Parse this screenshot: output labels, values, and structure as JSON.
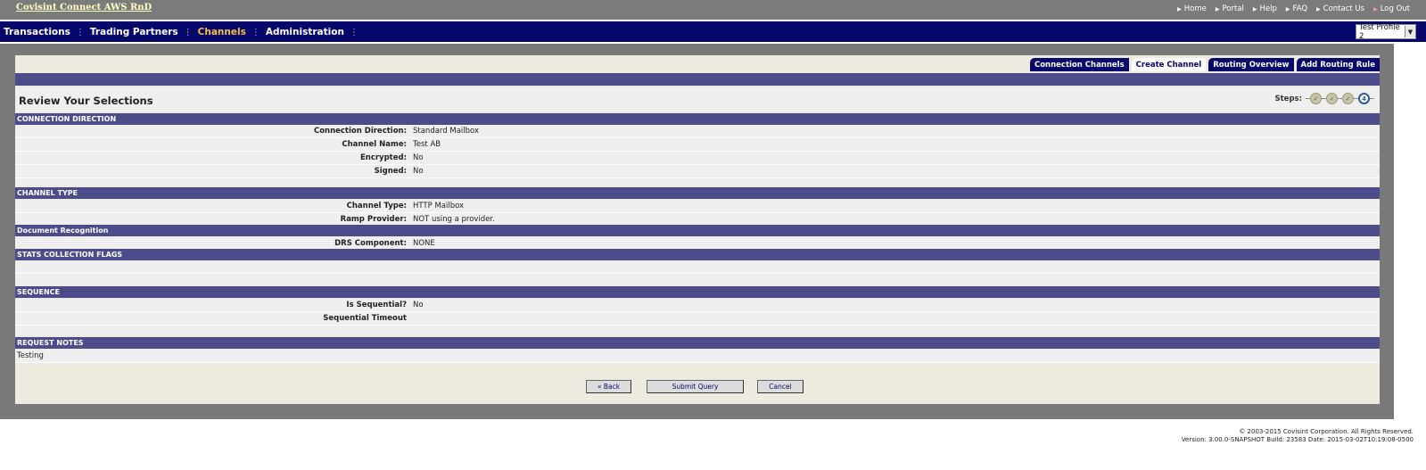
{
  "header": {
    "brand": "Covisint Connect AWS RnD",
    "links": [
      "Home",
      "Portal",
      "Help",
      "FAQ",
      "Contact Us",
      "Log Out"
    ]
  },
  "nav": {
    "items": [
      "Transactions",
      "Trading Partners",
      "Channels",
      "Administration"
    ],
    "active": "Channels",
    "profile": "Test Profile 2"
  },
  "tabs": [
    "Connection Channels",
    "Create Channel",
    "Routing Overview",
    "Add Routing Rule"
  ],
  "active_tab": "Create Channel",
  "review": {
    "title": "Review Your Selections",
    "steps_label": "Steps:",
    "current_step": "4"
  },
  "sections": {
    "connection_direction": {
      "title": "CONNECTION DIRECTION",
      "rows": [
        {
          "label": "Connection Direction:",
          "value": "Standard Mailbox"
        },
        {
          "label": "Channel Name:",
          "value": "Test AB"
        },
        {
          "label": "Encrypted:",
          "value": "No"
        },
        {
          "label": "Signed:",
          "value": "No"
        }
      ]
    },
    "channel_type": {
      "title": "CHANNEL TYPE",
      "rows": [
        {
          "label": "Channel Type:",
          "value": "HTTP Mailbox"
        },
        {
          "label": "Ramp Provider:",
          "value": "NOT using a provider."
        }
      ]
    },
    "document_recognition": {
      "title": "Document Recognition",
      "rows": [
        {
          "label": "DRS Component:",
          "value": "NONE"
        }
      ]
    },
    "stats": {
      "title": "STATS COLLECTION FLAGS"
    },
    "sequence": {
      "title": "SEQUENCE",
      "rows": [
        {
          "label": "Is Sequential?",
          "value": "No"
        },
        {
          "label": "Sequential Timeout",
          "value": ""
        }
      ]
    },
    "request_notes": {
      "title": "REQUEST NOTES",
      "text": "Testing"
    }
  },
  "buttons": {
    "back": "« Back",
    "submit": "Submit Query",
    "cancel": "Cancel"
  },
  "footer": {
    "copyright": "© 2003-2015 Covisint Corporation. All Rights Reserved.",
    "version": "Version:  3.00.0-SNAPSHOT   Build:  23583   Date:  2015-03-02T10:19:08-0500"
  }
}
